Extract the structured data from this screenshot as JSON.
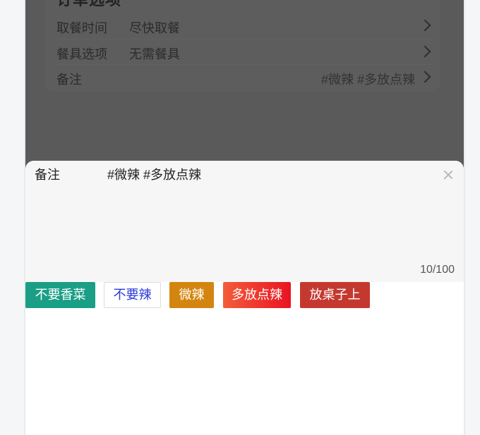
{
  "order": {
    "title": "订单选项",
    "rows": [
      {
        "label": "取餐时间",
        "value": "尽快取餐"
      },
      {
        "label": "餐具选项",
        "value": "无需餐具"
      },
      {
        "label": "备注",
        "value": "#微辣 #多放点辣"
      }
    ]
  },
  "remark_sheet": {
    "label": "备注",
    "value": "#微辣 #多放点辣",
    "counter": "10/100",
    "tags": [
      "不要香菜",
      "不要辣",
      "微辣",
      "多放点辣",
      "放桌子上"
    ]
  },
  "colors": {
    "overlay": "#5a5a5a",
    "tag_green": "#1a9e86",
    "tag_blue_text": "#2a3bd6",
    "tag_orange": "#d4850f",
    "tag_red_gradient_start": "#f25d3a",
    "tag_red_gradient_end": "#ea1323",
    "tag_dark_red": "#c4392f"
  }
}
